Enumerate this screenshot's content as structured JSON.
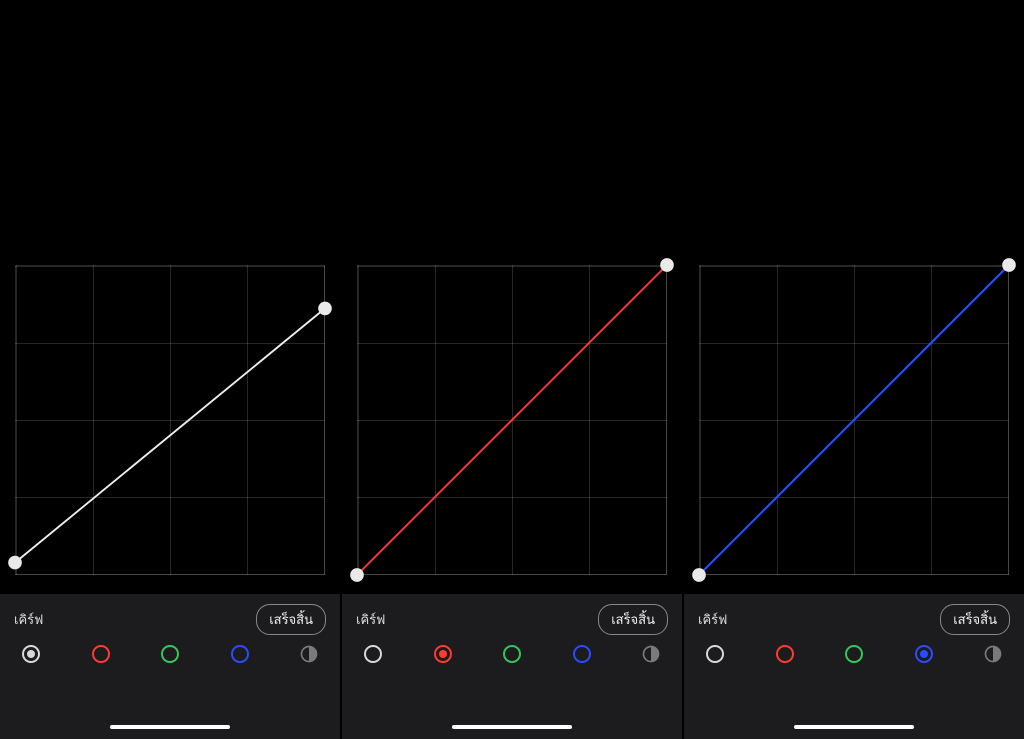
{
  "labels": {
    "title": "เคิร์ฟ",
    "done": "เสร็จสิ้น"
  },
  "colors": {
    "white": "#d8d8d8",
    "red": "#ff3b30",
    "green": "#34c759",
    "blue": "#2a4cff",
    "bw": "#7a7a7a"
  },
  "chart_data": [
    {
      "type": "line",
      "title": "เคิร์ฟ",
      "channel": "white",
      "x": [
        0,
        255
      ],
      "y": [
        10,
        220
      ],
      "xlim": [
        0,
        255
      ],
      "ylim": [
        0,
        255
      ],
      "line_color": "#eeeeee"
    },
    {
      "type": "line",
      "title": "เคิร์ฟ",
      "channel": "red",
      "x": [
        0,
        255
      ],
      "y": [
        0,
        255
      ],
      "xlim": [
        0,
        255
      ],
      "ylim": [
        0,
        255
      ],
      "line_color": "#ff3b30"
    },
    {
      "type": "line",
      "title": "เคิร์ฟ",
      "channel": "blue",
      "x": [
        0,
        255
      ],
      "y": [
        0,
        255
      ],
      "xlim": [
        0,
        255
      ],
      "ylim": [
        0,
        255
      ],
      "line_color": "#2a4cff"
    }
  ],
  "screens": [
    {
      "selected_channel": "white",
      "curve_index": 0
    },
    {
      "selected_channel": "red",
      "curve_index": 1
    },
    {
      "selected_channel": "blue",
      "curve_index": 2
    }
  ],
  "channels": [
    "white",
    "red",
    "green",
    "blue",
    "bw"
  ]
}
